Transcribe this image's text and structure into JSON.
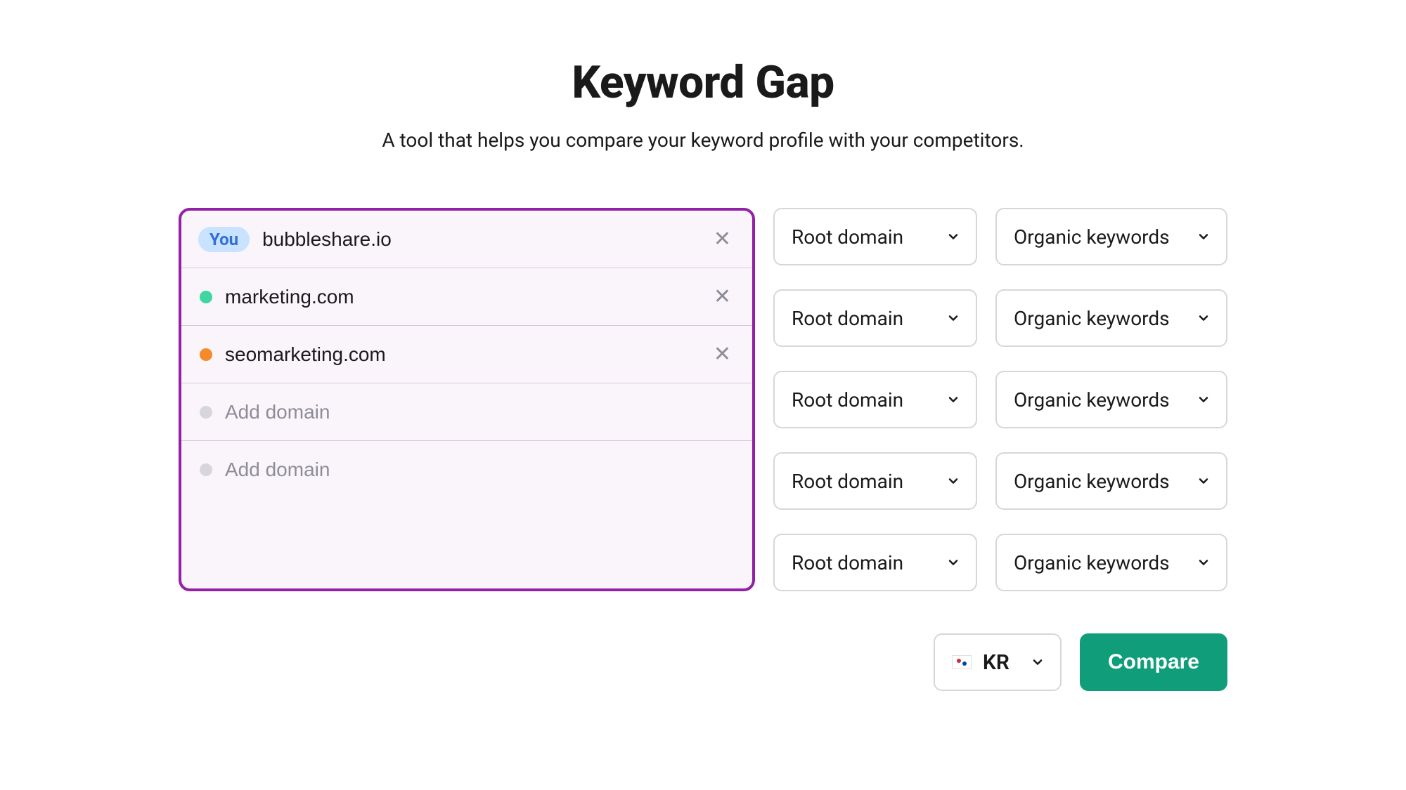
{
  "header": {
    "title": "Keyword Gap",
    "subtitle": "A tool that helps you compare your keyword profile with your competitors."
  },
  "you_badge": "You",
  "placeholder_add_domain": "Add domain",
  "rows": [
    {
      "indicator": "you",
      "color": "#c9e2ff",
      "domain": "bubbleshare.io",
      "has_clear": true,
      "scope": "Root domain",
      "keywords": "Organic keywords"
    },
    {
      "indicator": "dot",
      "color": "#3fd6a0",
      "domain": "marketing.com",
      "has_clear": true,
      "scope": "Root domain",
      "keywords": "Organic keywords"
    },
    {
      "indicator": "dot",
      "color": "#f58a2a",
      "domain": "seomarketing.com",
      "has_clear": true,
      "scope": "Root domain",
      "keywords": "Organic keywords"
    },
    {
      "indicator": "dot",
      "color": "#d6d6dc",
      "domain": "",
      "has_clear": false,
      "scope": "Root domain",
      "keywords": "Organic keywords"
    },
    {
      "indicator": "dot",
      "color": "#d6d6dc",
      "domain": "",
      "has_clear": false,
      "scope": "Root domain",
      "keywords": "Organic keywords"
    }
  ],
  "country": {
    "code": "KR"
  },
  "compare_label": "Compare",
  "colors": {
    "highlight_border": "#9321a5",
    "compare_bg": "#0f9d7a"
  }
}
